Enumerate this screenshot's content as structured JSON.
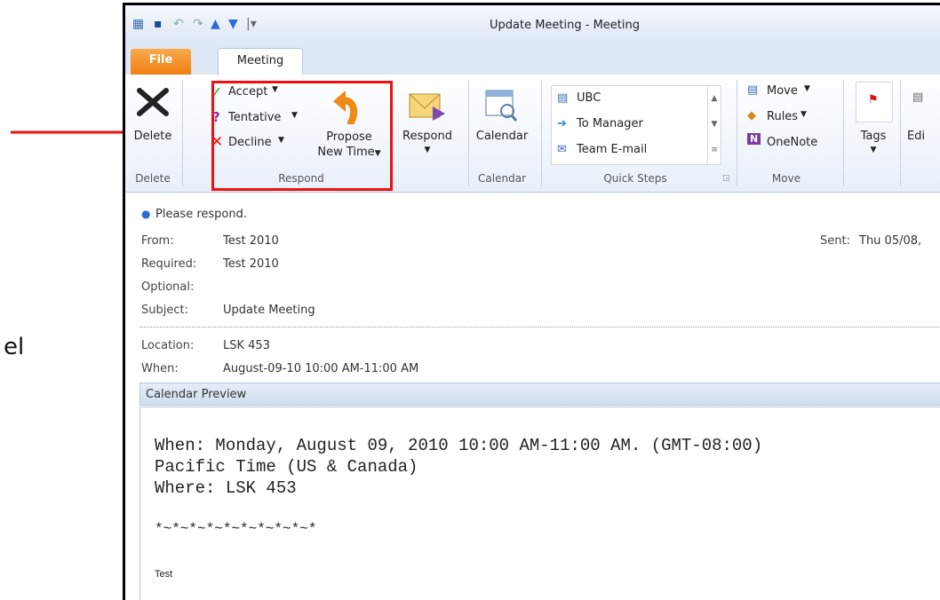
{
  "background_fragment": "el",
  "window": {
    "title": "Update Meeting - Meeting"
  },
  "tabs": {
    "file": "File",
    "meeting": "Meeting"
  },
  "ribbon": {
    "delete": {
      "button": "Delete",
      "group": "Delete"
    },
    "respond": {
      "accept": "Accept",
      "tentative": "Tentative",
      "decline": "Decline",
      "propose_line1": "Propose",
      "propose_line2": "New Time",
      "respond": "Respond",
      "group": "Respond"
    },
    "calendar": {
      "button": "Calendar",
      "group": "Calendar"
    },
    "quick_steps": {
      "items": [
        "UBC",
        "To Manager",
        "Team E-mail"
      ],
      "group": "Quick Steps"
    },
    "move": {
      "move": "Move",
      "rules": "Rules",
      "onenote": "OneNote",
      "group": "Move"
    },
    "tags": {
      "button": "Tags"
    },
    "edit": {
      "button": "Edi"
    }
  },
  "info_bar": "Please respond.",
  "header": {
    "from_label": "From:",
    "from": "Test 2010",
    "sent_label": "Sent:",
    "sent": "Thu 05/08,",
    "required_label": "Required:",
    "required": "Test 2010",
    "optional_label": "Optional:",
    "optional": "",
    "subject_label": "Subject:",
    "subject": "Update Meeting",
    "location_label": "Location:",
    "location": "LSK 453",
    "when_label": "When:",
    "when": "August-09-10 10:00 AM-11:00 AM"
  },
  "preview": {
    "title": "Calendar Preview",
    "line1": "When: Monday, August 09, 2010 10:00 AM-11:00 AM. (GMT-08:00)",
    "line2": "Pacific Time (US & Canada)",
    "line3": "Where: LSK 453",
    "line4": "*~*~*~*~*~*~*~*~*~*",
    "line5": "Test"
  },
  "colors": {
    "highlight": "#e11111",
    "file_tab": "#ee7d11",
    "ribbon_bg": "#e9f0fa"
  }
}
